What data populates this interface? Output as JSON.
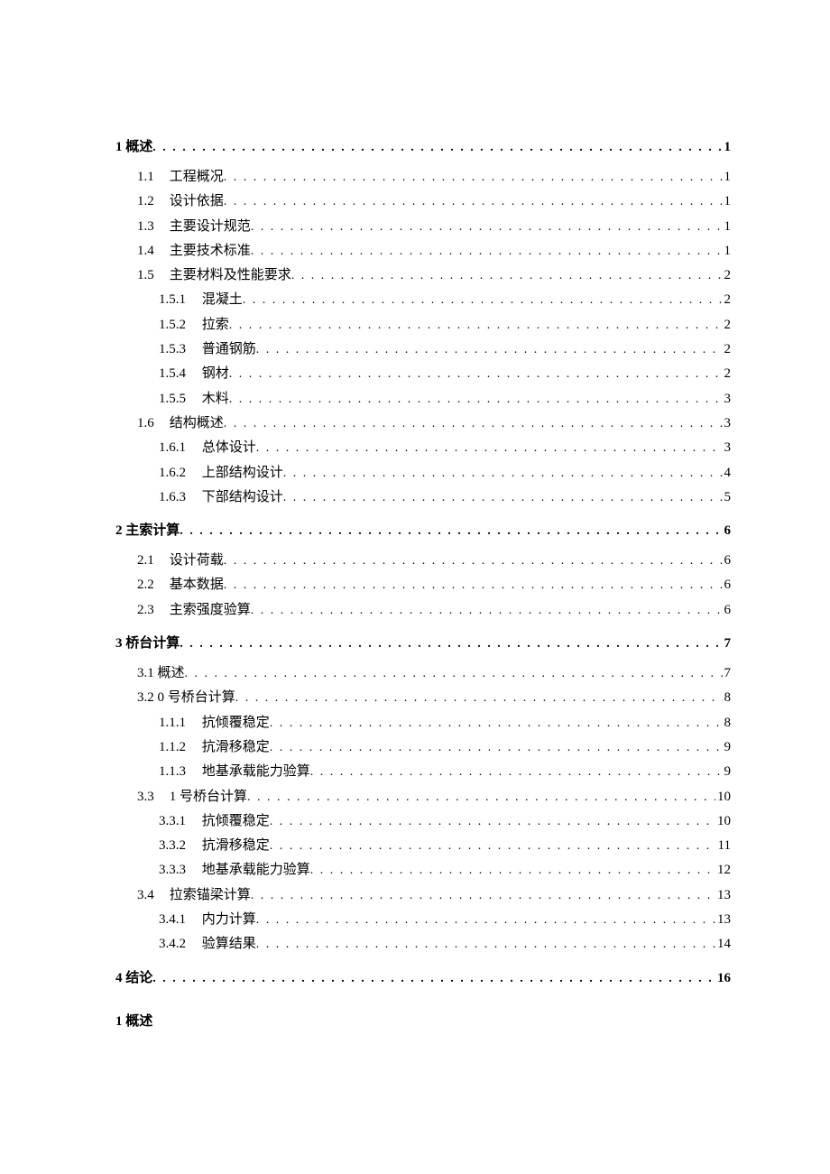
{
  "toc": [
    {
      "level": 1,
      "num": "1",
      "title": "概述",
      "page": "1",
      "sep": " "
    },
    {
      "level": 2,
      "num": "1.1",
      "title": "工程概况",
      "page": "1"
    },
    {
      "level": 2,
      "num": "1.2",
      "title": "设计依据",
      "page": "1"
    },
    {
      "level": 2,
      "num": "1.3",
      "title": "主要设计规范",
      "page": "1"
    },
    {
      "level": 2,
      "num": "1.4",
      "title": "主要技术标准",
      "page": "1"
    },
    {
      "level": 2,
      "num": "1.5",
      "title": "主要材料及性能要求",
      "page": "2"
    },
    {
      "level": 3,
      "num": "1.5.1",
      "title": "混凝土",
      "page": "2"
    },
    {
      "level": 3,
      "num": "1.5.2",
      "title": "拉索",
      "page": "2"
    },
    {
      "level": 3,
      "num": "1.5.3",
      "title": "普通钢筋",
      "page": "2"
    },
    {
      "level": 3,
      "num": "1.5.4",
      "title": "钢材",
      "page": "2"
    },
    {
      "level": 3,
      "num": "1.5.5",
      "title": "木料",
      "page": "3"
    },
    {
      "level": 2,
      "num": "1.6",
      "title": "结构概述",
      "page": "3"
    },
    {
      "level": 3,
      "num": "1.6.1",
      "title": "总体设计",
      "page": "3"
    },
    {
      "level": 3,
      "num": "1.6.2",
      "title": "上部结构设计",
      "page": "4"
    },
    {
      "level": 3,
      "num": "1.6.3",
      "title": "下部结构设计",
      "page": "5"
    },
    {
      "level": 1,
      "num": "2",
      "title": "主索计算",
      "page": "6",
      "sep": " "
    },
    {
      "level": 2,
      "num": "2.1",
      "title": "设计荷载",
      "page": "6"
    },
    {
      "level": 2,
      "num": "2.2",
      "title": "基本数据",
      "page": "6"
    },
    {
      "level": 2,
      "num": "2.3",
      "title": "主索强度验算",
      "page": "6"
    },
    {
      "level": 1,
      "num": "3",
      "title": "桥台计算",
      "page": "7",
      "sep": " "
    },
    {
      "level": 2,
      "num": "3.1",
      "title": "概述",
      "page": "7",
      "tight": true
    },
    {
      "level": 2,
      "num": "3.2",
      "title": "0 号桥台计算",
      "page": "8",
      "tight": true
    },
    {
      "level": 3,
      "num": "1.1.1",
      "title": "抗倾覆稳定",
      "page": "8"
    },
    {
      "level": 3,
      "num": "1.1.2",
      "title": "抗滑移稳定",
      "page": "9"
    },
    {
      "level": 3,
      "num": "1.1.3",
      "title": "地基承载能力验算",
      "page": "9"
    },
    {
      "level": 2,
      "num": "3.3",
      "title": "1 号桥台计算",
      "page": "10"
    },
    {
      "level": 3,
      "num": "3.3.1",
      "title": "抗倾覆稳定",
      "page": "10"
    },
    {
      "level": 3,
      "num": "3.3.2",
      "title": "抗滑移稳定",
      "page": "11"
    },
    {
      "level": 3,
      "num": "3.3.3",
      "title": "地基承载能力验算",
      "page": "12"
    },
    {
      "level": 2,
      "num": "3.4",
      "title": "拉索锚梁计算",
      "page": "13"
    },
    {
      "level": 3,
      "num": "3.4.1",
      "title": "内力计算",
      "page": "13"
    },
    {
      "level": 3,
      "num": "3.4.2",
      "title": "验算结果",
      "page": "14"
    },
    {
      "level": 1,
      "num": "4",
      "title": "结论",
      "page": "16",
      "sep": " "
    }
  ],
  "after_heading": {
    "num": "1",
    "title": "概述"
  }
}
